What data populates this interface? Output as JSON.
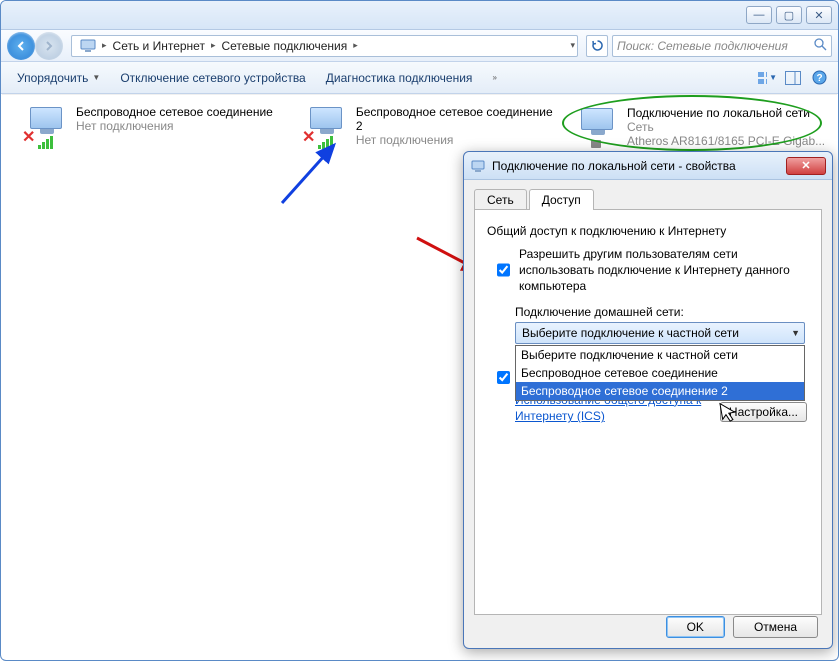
{
  "window": {
    "minimize": "—",
    "maximize": "▢",
    "close": "✕"
  },
  "breadcrumb": {
    "seg1": "Сеть и Интернет",
    "seg2": "Сетевые подключения"
  },
  "search": {
    "placeholder": "Поиск: Сетевые подключения"
  },
  "toolbar": {
    "organize": "Упорядочить",
    "disable": "Отключение сетевого устройства",
    "diagnose": "Диагностика подключения"
  },
  "connections": {
    "wifi1": {
      "name": "Беспроводное сетевое соединение",
      "status": "Нет подключения"
    },
    "wifi2": {
      "name": "Беспроводное сетевое соединение 2",
      "status": "Нет подключения"
    },
    "lan": {
      "name": "Подключение по локальной сети",
      "status": "Сеть",
      "device": "Atheros AR8161/8165 PCI-E Gigab..."
    }
  },
  "dialog": {
    "title": "Подключение по локальной сети - свойства",
    "tabs": {
      "network": "Сеть",
      "access": "Доступ"
    },
    "group": "Общий доступ к подключению к Интернету",
    "chk1": "Разрешить другим пользователям сети использовать подключение к Интернету данного компьютера",
    "home_label": "Подключение домашней сети:",
    "combo_value": "Выберите подключение к частной сети",
    "options": {
      "o1": "Выберите подключение к частной сети",
      "o2": "Беспроводное сетевое соединение",
      "o3": "Беспроводное сетевое соединение 2"
    },
    "link": "Использование общего доступа к Интернету (ICS)",
    "settings": "Настройка...",
    "ok": "OK",
    "cancel": "Отмена"
  }
}
